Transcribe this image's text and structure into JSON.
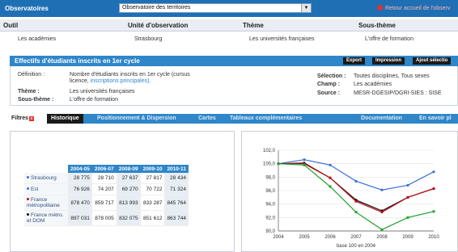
{
  "app_title": "Observatoires",
  "top_select": "Observatoire des territoires",
  "top_back": "Retour accueil de l'observ",
  "columns": [
    {
      "label": "Outil",
      "value": "Les académies"
    },
    {
      "label": "Unité d'observation",
      "value": "Strasbourg"
    },
    {
      "label": "Thème",
      "value": "Les universités françaises"
    },
    {
      "label": "Sous-thème",
      "value": "L'offre de formation"
    }
  ],
  "panel": {
    "title": "Effectifs d'étudiants inscrits en 1er cycle",
    "buttons": [
      "Export",
      "Impression",
      "Ajout sélectio"
    ],
    "definition_label": "Définition :",
    "definition_text": "Nombre d'étudiants inscrits en 1er cycle (cursus",
    "definition_text2": "licence,",
    "definition_link": "inscriptions principales).",
    "theme_label": "Thème :",
    "theme_value": "Les universités françaises",
    "subtheme_label": "Sous-thème :",
    "subtheme_value": "L'offre de formation",
    "selection_label": "Sélection :",
    "selection_value": "Toutes disciplines, Tous sexes",
    "champ_label": "Champ :",
    "champ_value": "Les académies",
    "source_label": "Source :",
    "source_value": "MESR-DGESIP/DGRI-SIES : SISE"
  },
  "tabs": {
    "filtres": "Filtres",
    "items": [
      "Historique",
      "Positionnement & Dispersion",
      "Cartes",
      "Tableaux complémentaires",
      "Documentation",
      "En savoir pl"
    ]
  },
  "table": {
    "headers": [
      "2004-05",
      "2006-07",
      "2008-09",
      "2009-10",
      "2010-11"
    ],
    "rows": [
      {
        "label": "Strasbourg",
        "values": [
          "28 775",
          "28 710",
          "27 637",
          "27 817",
          "28 434"
        ]
      },
      {
        "label": "Est",
        "values": [
          "76 926",
          "74 207",
          "69 270",
          "70 722",
          "71 324"
        ]
      },
      {
        "label": "France métropolitaine",
        "values": [
          "878 470",
          "859 717",
          "813 993",
          "833 287",
          "845 764"
        ]
      },
      {
        "label": "France métro. et DOM",
        "values": [
          "897 031",
          "878 005",
          "832 075",
          "851 612",
          "863 744"
        ]
      }
    ]
  },
  "colors": {
    "accent": "#2f86c9",
    "blue": "#3a6fd8",
    "black": "#111111",
    "red": "#c0101a",
    "green": "#1fa02b"
  },
  "chart_data": {
    "type": "line",
    "x": [
      2004,
      2005,
      2006,
      2007,
      2008,
      2009,
      2010
    ],
    "xlabel": "base 100 en 2004",
    "ylim": [
      90,
      102
    ],
    "yticks": [
      "90,0",
      "92,0",
      "94,0",
      "96,0",
      "98,0",
      "100,0",
      "102,0"
    ],
    "series": [
      {
        "color": "#3a6fd8",
        "values": [
          100.0,
          100.6,
          99.8,
          97.4,
          96.1,
          96.8,
          98.8
        ]
      },
      {
        "color": "#111111",
        "values": [
          100.0,
          100.1,
          97.9,
          94.6,
          93.0,
          95.0,
          96.3
        ]
      },
      {
        "color": "#c0101a",
        "values": [
          100.0,
          100.0,
          97.9,
          94.4,
          92.8,
          95.0,
          96.3
        ]
      },
      {
        "color": "#1fa02b",
        "values": [
          100.0,
          99.8,
          96.6,
          92.8,
          90.2,
          92.0,
          92.9
        ]
      }
    ]
  }
}
